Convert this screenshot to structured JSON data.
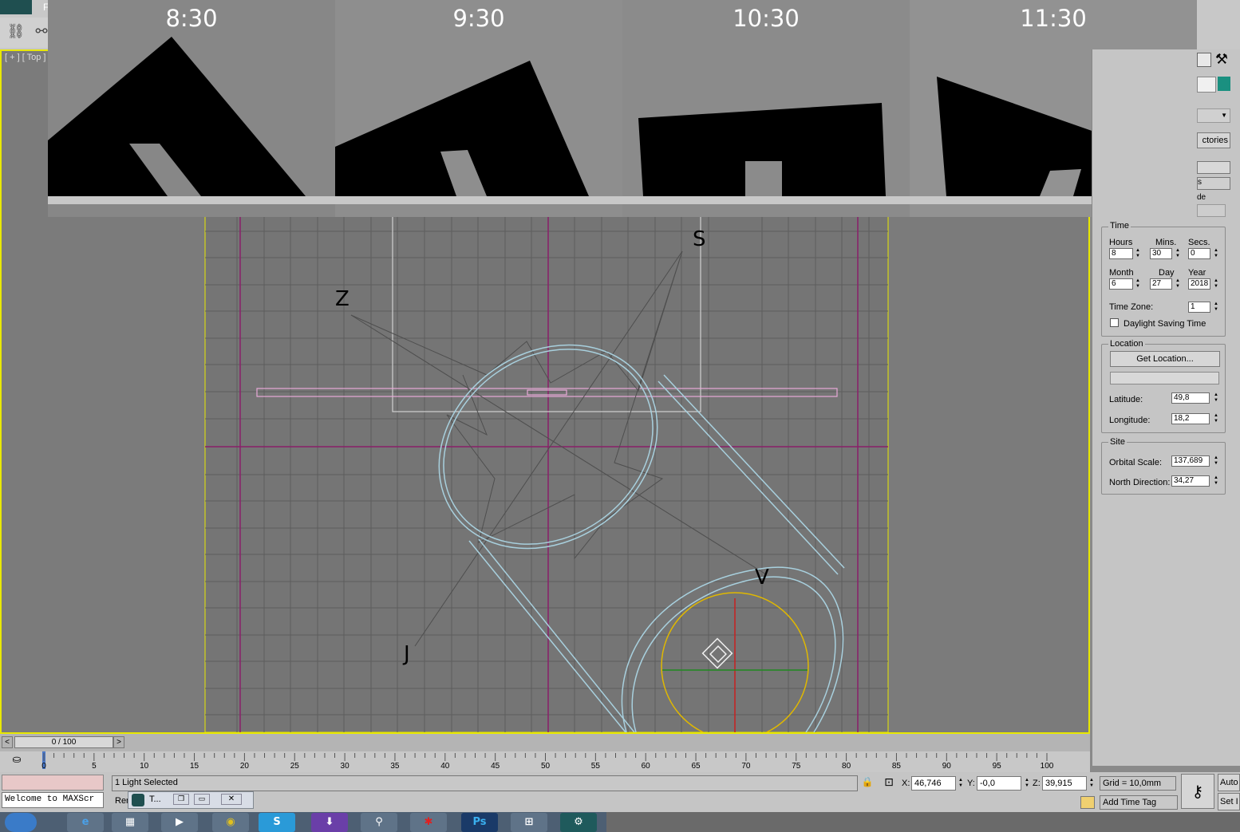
{
  "window": {
    "app_letter": "F"
  },
  "viewport": {
    "label": "[ + ] [ Top ]",
    "axis_labels": [
      "Z",
      "S",
      "V",
      "J"
    ]
  },
  "sun_panels": [
    {
      "time": "8:30"
    },
    {
      "time": "9:30"
    },
    {
      "time": "10:30"
    },
    {
      "time": "11:30"
    }
  ],
  "command_panel": {
    "partial_labels": {
      "dropdown": "",
      "trajectories": "ctories",
      "s": "s",
      "de": "de"
    },
    "time": {
      "title": "Time",
      "hours_label": "Hours",
      "hours": "8",
      "mins_label": "Mins.",
      "mins": "30",
      "secs_label": "Secs.",
      "secs": "0",
      "month_label": "Month",
      "month": "6",
      "day_label": "Day",
      "day": "27",
      "year_label": "Year",
      "year": "2018",
      "timezone_label": "Time Zone:",
      "timezone": "1",
      "dst_label": "Daylight Saving Time"
    },
    "location": {
      "title": "Location",
      "get_location": "Get Location...",
      "latitude_label": "Latitude:",
      "latitude": "49,8",
      "longitude_label": "Longitude:",
      "longitude": "18,2"
    },
    "site": {
      "title": "Site",
      "orbital_label": "Orbital Scale:",
      "orbital": "137,689",
      "north_label": "North Direction:",
      "north": "34,27"
    }
  },
  "timeline": {
    "slider": "0 / 100",
    "ticks": [
      "0",
      "5",
      "10",
      "15",
      "20",
      "25",
      "30",
      "35",
      "40",
      "45",
      "50",
      "55",
      "60",
      "65",
      "70",
      "75",
      "80",
      "85",
      "90",
      "95",
      "100"
    ]
  },
  "status": {
    "selection": "1 Light Selected",
    "maxscript": "Welcome to MAXScr",
    "render_prefix": "Ren",
    "x_label": "X:",
    "x": "46,746",
    "y_label": "Y:",
    "y": "-0,0",
    "z_label": "Z:",
    "z": "39,915",
    "grid": "Grid = 10,0mm",
    "add_time_tag": "Add Time Tag",
    "auto": "Auto",
    "set": "Set I"
  },
  "taskbar": {
    "popup_title": "T...",
    "ps_label": "Ps"
  },
  "colors": {
    "viewport_border": "#e8e800",
    "accent": "#1a9080"
  }
}
